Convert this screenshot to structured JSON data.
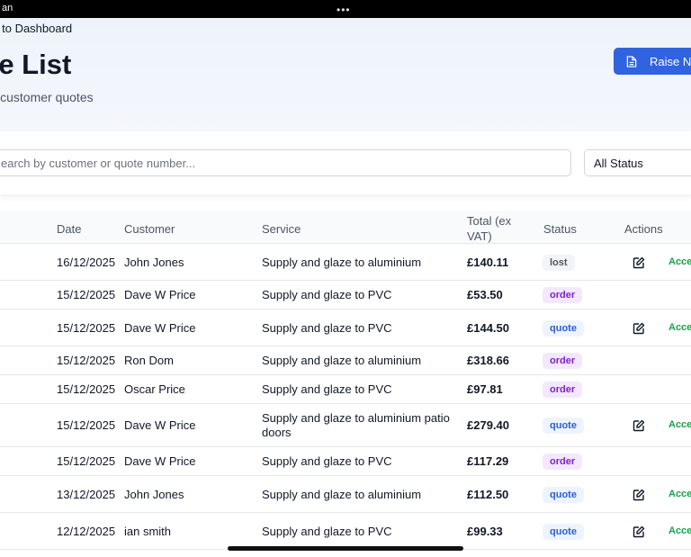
{
  "status_bar": {
    "left_text": "an",
    "center_glyph": "•••"
  },
  "header": {
    "back_label": "k to Dashboard",
    "title": "te List",
    "subtitle": "ll customer quotes",
    "raise_button_label": "Raise Ne"
  },
  "filters": {
    "search_placeholder": "earch by customer or quote number...",
    "status_selected": "All Status"
  },
  "table": {
    "columns": {
      "date": "Date",
      "customer": "Customer",
      "service": "Service",
      "total": "Total (ex VAT)",
      "status": "Status",
      "actions": "Actions"
    },
    "accept_label": "Acce",
    "rows": [
      {
        "date": "16/12/2025",
        "customer": "John Jones",
        "service": "Supply and glaze to aluminium",
        "total": "£140.11",
        "status": "lost",
        "editable": true
      },
      {
        "date": "15/12/2025",
        "customer": "Dave W Price",
        "service": "Supply and glaze to PVC",
        "total": "£53.50",
        "status": "order",
        "editable": false
      },
      {
        "date": "15/12/2025",
        "customer": "Dave W Price",
        "service": "Supply and glaze to PVC",
        "total": "£144.50",
        "status": "quote",
        "editable": true
      },
      {
        "date": "15/12/2025",
        "customer": "Ron Dom",
        "service": "Supply and glaze to aluminium",
        "total": "£318.66",
        "status": "order",
        "editable": false
      },
      {
        "date": "15/12/2025",
        "customer": "Oscar Price",
        "service": "Supply and glaze to PVC",
        "total": "£97.81",
        "status": "order",
        "editable": false
      },
      {
        "date": "15/12/2025",
        "customer": "Dave W Price",
        "service": "Supply and glaze to aluminium patio doors",
        "total": "£279.40",
        "status": "quote",
        "editable": true
      },
      {
        "date": "15/12/2025",
        "customer": "Dave W Price",
        "service": "Supply and glaze to PVC",
        "total": "£117.29",
        "status": "order",
        "editable": false
      },
      {
        "date": "13/12/2025",
        "customer": "John Jones",
        "service": "Supply and glaze to aluminium",
        "total": "£112.50",
        "status": "quote",
        "editable": true
      },
      {
        "date": "12/12/2025",
        "customer": "ian smith",
        "service": "Supply and glaze to PVC",
        "total": "£99.33",
        "status": "quote",
        "editable": true
      }
    ]
  },
  "icons": {
    "raise_button": "document-icon",
    "edit": "edit-icon"
  },
  "colors": {
    "primary": "#2f63e0",
    "accept": "#16a34a",
    "order_badge": "#7e22ce",
    "quote_badge": "#2b5fd0",
    "lost_badge": "#4b5563"
  }
}
